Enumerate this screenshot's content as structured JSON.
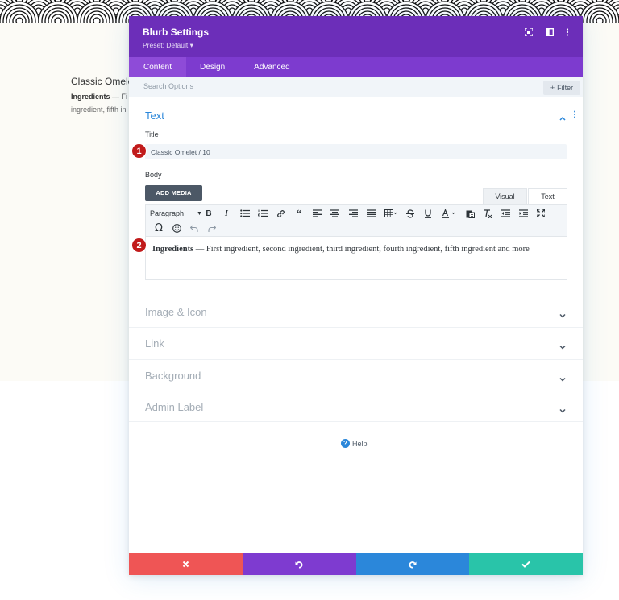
{
  "background_page": {
    "title": "Classic Omelet",
    "body_bold": "Ingredients",
    "body_line1": " — Fi",
    "body_line2": "ingredient, fifth in"
  },
  "modal": {
    "title": "Blurb Settings",
    "preset": "Preset: Default ▾",
    "header_icons": [
      "screenshot-icon",
      "split-view-icon",
      "more-icon"
    ],
    "tabs": [
      {
        "label": "Content",
        "active": true
      },
      {
        "label": "Design",
        "active": false
      },
      {
        "label": "Advanced",
        "active": false
      }
    ],
    "search": {
      "placeholder": "Search Options"
    },
    "filter_label": "Filter",
    "text_section": {
      "title": "Text",
      "title_label": "Title",
      "title_value": "Classic Omelet / 10",
      "body_label": "Body",
      "add_media": "ADD MEDIA",
      "visual_tab": "Visual",
      "text_tab": "Text",
      "paragraph": "Paragraph",
      "body_bold": "Ingredients",
      "body_rest": " — First ingredient, second ingredient, third ingredient, fourth ingredient, fifth ingredient and more"
    },
    "badges": [
      "1",
      "2"
    ],
    "accordions": [
      {
        "title": "Image & Icon"
      },
      {
        "title": "Link"
      },
      {
        "title": "Background"
      },
      {
        "title": "Admin Label"
      }
    ],
    "help_label": "Help",
    "footer": {
      "colors": {
        "cancel": "#ef5555",
        "undo": "#7e3bd0",
        "redo": "#2b87da",
        "save": "#29c4a9"
      }
    }
  },
  "colors": {
    "purple_dark": "#6c2eb9",
    "purple_tab": "#7d3bcf",
    "accent_blue": "#2b87da",
    "badge_red": "#c11b1b"
  }
}
